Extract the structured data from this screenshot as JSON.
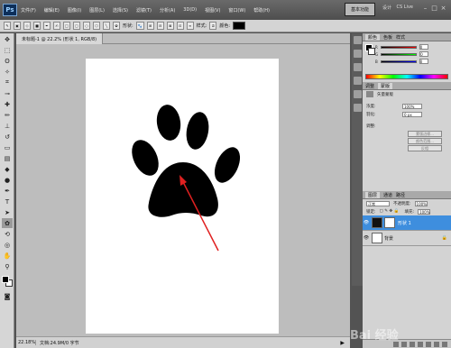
{
  "app": {
    "logo": "Ps",
    "menus": [
      "文件(F)",
      "编辑(E)",
      "图像(I)",
      "图层(L)",
      "选择(S)",
      "滤镜(T)",
      "分析(A)",
      "3D(D)",
      "视图(V)",
      "窗口(W)",
      "帮助(H)"
    ],
    "zoom_control": "22.2",
    "workspace": "基本功能",
    "workspace_alt": "设计",
    "workspace_alt2": "绘画",
    "cs_live": "CS Live",
    "win_controls": [
      "–",
      "□",
      "×"
    ]
  },
  "options_bar": {
    "shape_label": "形状:",
    "style_label": "样式:",
    "color_label": "颜色:"
  },
  "document": {
    "tab_title": "未标题-1 @ 22.2% (形状 1, RGB/8)",
    "zoom": "22.18%",
    "info": "文档:24.9M/0 字节"
  },
  "panels": {
    "color_tabs": [
      "颜色",
      "色板",
      "样式"
    ],
    "rgb_labels": [
      "R",
      "G",
      "B"
    ],
    "rgb_values": [
      "0",
      "0",
      "0"
    ],
    "adjust_tabs": [
      "调整",
      "蒙版"
    ],
    "mask_title": "矢量蒙版",
    "density_label": "浓度:",
    "density_value": "100%",
    "feather_label": "羽化:",
    "feather_value": "0 px",
    "refine_label": "调整:",
    "btn_edge": "蒙版边缘...",
    "btn_color_range": "颜色范围...",
    "btn_invert": "反相",
    "layer_tabs": [
      "图层",
      "通道",
      "路径"
    ],
    "blend_mode": "正常",
    "opacity_label": "不透明度:",
    "opacity_value": "100%",
    "lock_label": "锁定:",
    "fill_label": "填充:",
    "fill_value": "100%",
    "layers": [
      {
        "name": "形状 1",
        "selected": true
      },
      {
        "name": "背景",
        "selected": false
      }
    ]
  },
  "watermark": "Bai 经验",
  "colors": {
    "arrow": "#e02020",
    "paw": "#000000",
    "layer_selected": "#3e8ede"
  }
}
